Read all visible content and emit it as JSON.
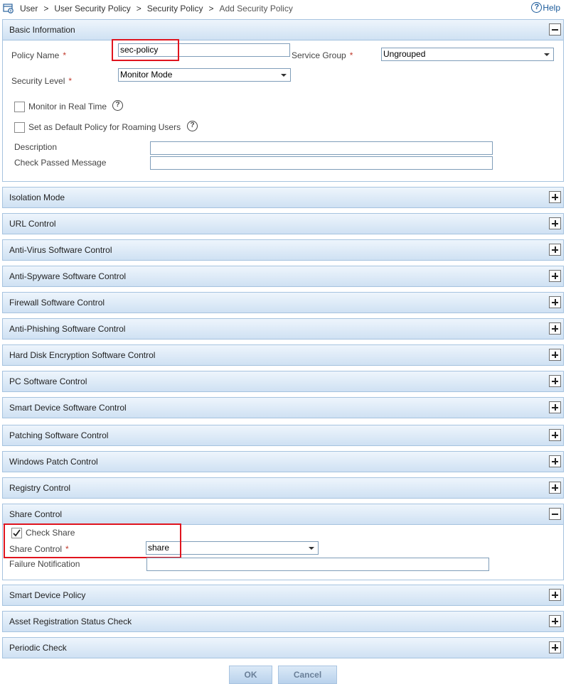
{
  "breadcrumb": {
    "items": [
      "User",
      "User Security Policy",
      "Security Policy",
      "Add Security Policy"
    ],
    "separator": ">"
  },
  "help": {
    "label": "Help"
  },
  "basic": {
    "title": "Basic Information",
    "policy_name_label": "Policy Name",
    "policy_name_value": "sec-policy",
    "service_group_label": "Service Group",
    "service_group_value": "Ungrouped",
    "security_level_label": "Security Level",
    "security_level_value": "Monitor Mode",
    "monitor_label": "Monitor in Real Time",
    "roaming_label": "Set as Default Policy for Roaming Users",
    "description_label": "Description",
    "description_value": "",
    "check_passed_label": "Check Passed Message",
    "check_passed_value": "",
    "required_mark": "*",
    "help_glyph": "?"
  },
  "sections_collapsed_a": [
    "Isolation Mode",
    "URL Control",
    "Anti-Virus Software Control",
    "Anti-Spyware Software Control",
    "Firewall Software Control",
    "Anti-Phishing Software Control",
    "Hard Disk Encryption Software Control",
    "PC Software Control",
    "Smart Device Software Control",
    "Patching Software Control",
    "Windows Patch Control",
    "Registry Control"
  ],
  "share": {
    "title": "Share Control",
    "check_share_label": "Check Share",
    "check_share_checked": true,
    "share_control_label": "Share Control",
    "share_control_value": "share",
    "failure_label": "Failure Notification",
    "failure_value": ""
  },
  "sections_collapsed_b": [
    "Smart Device Policy",
    "Asset Registration Status Check",
    "Periodic Check"
  ],
  "buttons": {
    "ok": "OK",
    "cancel": "Cancel"
  },
  "colors": {
    "accent": "#1a5a9a",
    "highlight": "#e0141e",
    "bar": "#cfe1f3"
  },
  "icons": {
    "home": "user-policy-icon",
    "expand": "plus-icon",
    "collapse": "minus-icon",
    "help": "question-icon"
  }
}
